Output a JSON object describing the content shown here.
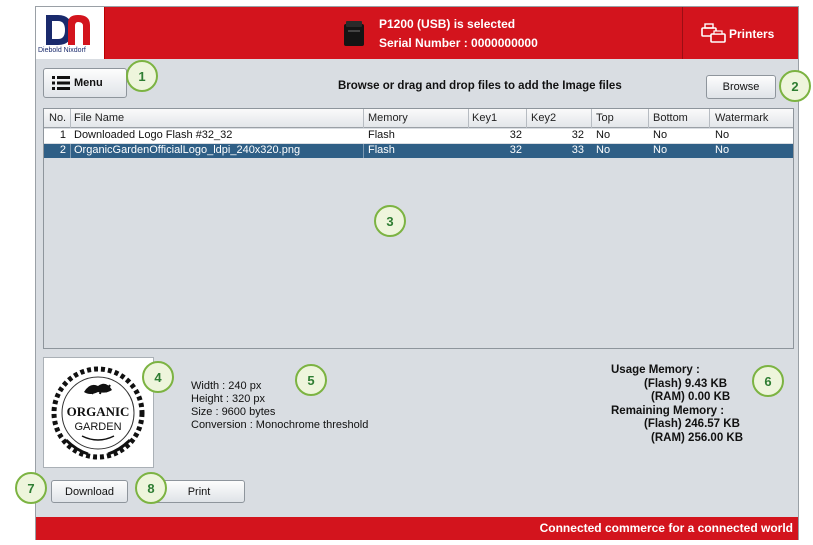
{
  "brand": {
    "logo_text": "Diebold Nixdorf"
  },
  "header": {
    "printer_line1": "P1200 (USB) is selected",
    "printer_line2": "Serial Number : 0000000000",
    "printers_label": "Printers"
  },
  "toolbar": {
    "menu_label": "Menu",
    "hint": "Browse or drag and drop files to add the Image files",
    "browse_label": "Browse"
  },
  "table": {
    "columns": [
      "No.",
      "File Name",
      "Memory",
      "Key1",
      "Key2",
      "Top",
      "Bottom",
      "Watermark"
    ],
    "rows": [
      {
        "no": "1",
        "file": "Downloaded Logo Flash #32_32",
        "memory": "Flash",
        "key1": "32",
        "key2": "32",
        "top": "No",
        "bottom": "No",
        "watermark": "No",
        "selected": false
      },
      {
        "no": "2",
        "file": "OrganicGardenOfficialLogo_ldpi_240x320.png",
        "memory": "Flash",
        "key1": "32",
        "key2": "33",
        "top": "No",
        "bottom": "No",
        "watermark": "No",
        "selected": true
      }
    ]
  },
  "preview": {
    "logo_line1": "ORGANIC",
    "logo_line2": "GARDEN"
  },
  "info": {
    "width": "Width : 240 px",
    "height": "Height : 320 px",
    "size": "Size : 9600 bytes",
    "conversion": "Conversion : Monochrome threshold"
  },
  "memory": {
    "usage_title": "Usage Memory :",
    "usage_flash": "(Flash) 9.43 KB",
    "usage_ram": "(RAM) 0.00 KB",
    "remaining_title": "Remaining Memory :",
    "remaining_flash": "(Flash) 246.57 KB",
    "remaining_ram": "(RAM) 256.00 KB"
  },
  "actions": {
    "download_label": "Download",
    "print_label": "Print"
  },
  "footer": {
    "tagline": "Connected commerce for a connected world"
  },
  "callouts": [
    "1",
    "2",
    "3",
    "4",
    "5",
    "6",
    "7",
    "8"
  ],
  "colors": {
    "brand_red": "#d3141d",
    "selection_blue": "#2f5f86",
    "callout_green": "#7cb342"
  }
}
